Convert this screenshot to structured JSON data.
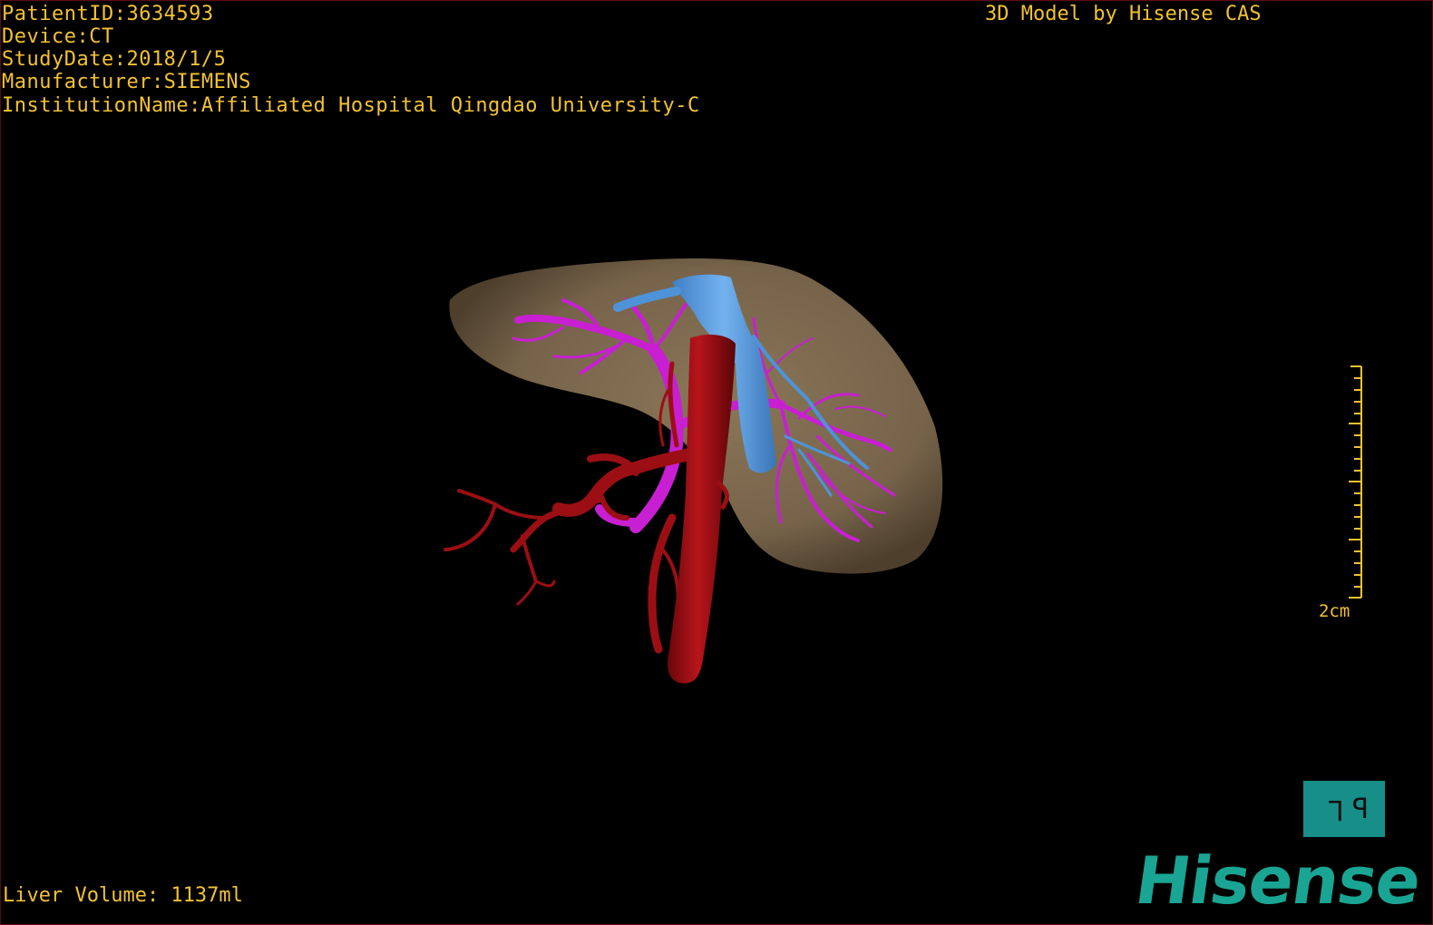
{
  "patient_info": {
    "patient_id": "PatientID:3634593",
    "device": "Device:CT",
    "study_date": "StudyDate:2018/1/5",
    "manufacturer": "Manufacturer:SIEMENS",
    "institution": "InstitutionName:Affiliated Hospital Qingdao University-C"
  },
  "credit": "3D Model by Hisense CAS",
  "liver_volume": "Liver Volume: 1137ml",
  "scale_bar": {
    "label": "2cm"
  },
  "orientation_button": {
    "label_left": "L",
    "label_right": "P"
  },
  "brand": "Hisense",
  "colors": {
    "overlay_text": "#f2c232",
    "liver": "#7d6a4e",
    "artery": "#9b0f14",
    "portal_vein": "#c81fd2",
    "hepatic_vein": "#5e9fe0",
    "brand": "#1aa493"
  }
}
